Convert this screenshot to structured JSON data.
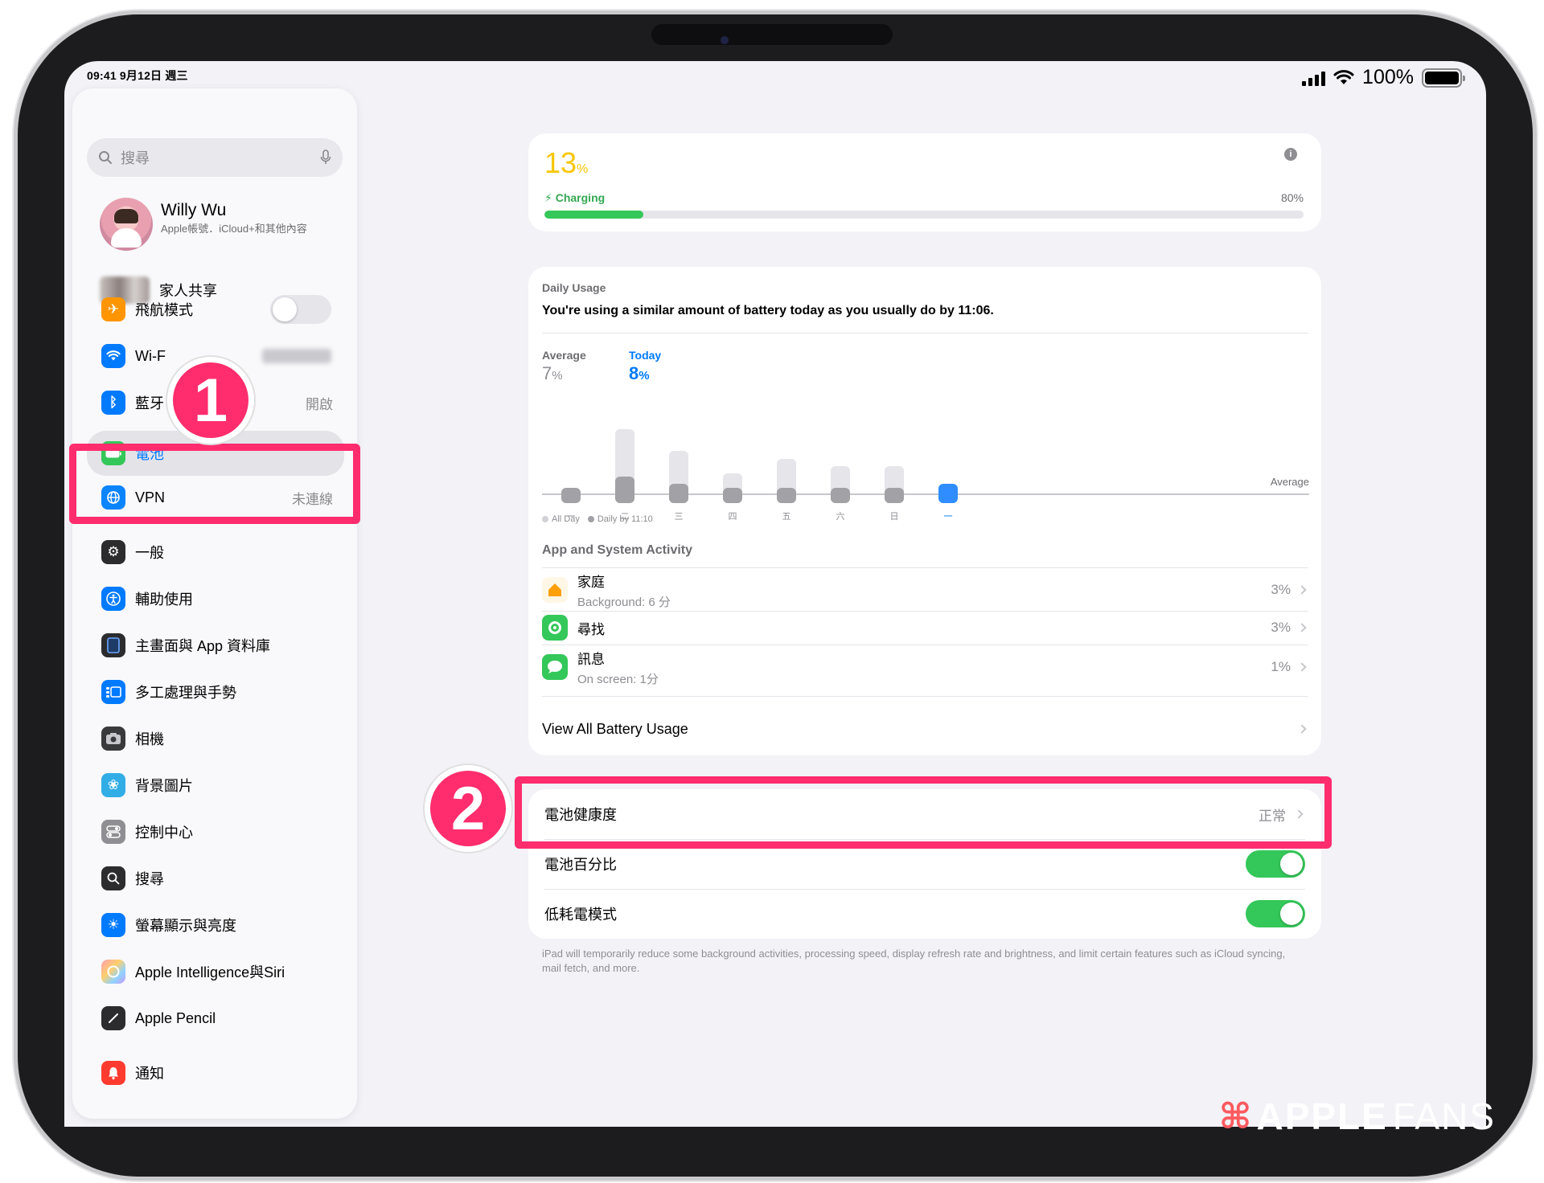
{
  "status_bar": {
    "time_date": "09:41  9月12日 週三",
    "battery_percent": "100%"
  },
  "sidebar": {
    "search_placeholder": "搜尋",
    "profile": {
      "name": "Willy Wu",
      "subtitle": "Apple帳號．iCloud+和其他內容"
    },
    "family_label": "家人共享",
    "group1": [
      {
        "label": "飛航模式",
        "icon": "airplane-icon",
        "color": "#ff9500"
      },
      {
        "label": "Wi-F",
        "icon": "wifi-icon",
        "color": "#007aff"
      },
      {
        "label": "藍牙",
        "icon": "bluetooth-icon",
        "color": "#007aff",
        "value": "開啟"
      },
      {
        "label": "電池",
        "icon": "battery-icon",
        "color": "#34c759",
        "selected": true
      },
      {
        "label": "VPN",
        "icon": "vpn-icon",
        "color": "#0a84ff",
        "value": "未連線"
      }
    ],
    "group2": [
      {
        "label": "一般",
        "icon": "gear-icon",
        "color": "#8e8e93"
      },
      {
        "label": "輔助使用",
        "icon": "accessibility-icon",
        "color": "#007aff"
      },
      {
        "label": "主畫面與 App 資料庫",
        "icon": "home-screen-icon",
        "color": "#2c2c2e"
      },
      {
        "label": "多工處理與手勢",
        "icon": "multitasking-icon",
        "color": "#007aff"
      },
      {
        "label": "相機",
        "icon": "camera-icon",
        "color": "#8e8e93"
      },
      {
        "label": "背景圖片",
        "icon": "wallpaper-icon",
        "color": "#32ade6"
      },
      {
        "label": "控制中心",
        "icon": "control-center-icon",
        "color": "#8e8e93"
      },
      {
        "label": "搜尋",
        "icon": "search-icon",
        "color": "#8e8e93"
      },
      {
        "label": "螢幕顯示與亮度",
        "icon": "brightness-icon",
        "color": "#007aff"
      },
      {
        "label": "Apple Intelligence與Siri",
        "icon": "siri-icon",
        "color": "#ff9fb2"
      },
      {
        "label": "Apple Pencil",
        "icon": "pencil-icon",
        "color": "#2c2c2e"
      },
      {
        "label": "通知",
        "icon": "bell-icon",
        "color": "#ff3b30"
      }
    ]
  },
  "charge_card": {
    "percent": "13",
    "percent_unit": "%",
    "status": "Charging",
    "limit": "80%",
    "level": 0.13,
    "colors": {
      "percent": "#f7c600",
      "bar": "#34c759"
    }
  },
  "usage_card": {
    "label": "Daily Usage",
    "message": "You're using a similar amount of battery today as you usually do by 11:06.",
    "average_label": "Average",
    "average_value": "7",
    "today_label": "Today",
    "today_value": "8",
    "unit": "%",
    "average_line_label": "Average",
    "legend_all_day": "All Day",
    "legend_daily_by": "Daily by 11:10",
    "activity_title": "App and System Activity",
    "apps": [
      {
        "name": "家庭",
        "sub": "Background: 6 分",
        "percent": "3%",
        "icon": "home-app-icon"
      },
      {
        "name": "尋找",
        "sub": "",
        "percent": "3%",
        "icon": "find-my-icon"
      },
      {
        "name": "訊息",
        "sub": "On screen: 1分",
        "percent": "1%",
        "icon": "messages-icon"
      }
    ],
    "view_all": "View All Battery Usage"
  },
  "chart_data": {
    "type": "bar",
    "categories": [
      "一",
      "二",
      "三",
      "四",
      "五",
      "六",
      "日",
      "一"
    ],
    "series": [
      {
        "values": [
          2,
          18,
          12,
          6,
          10,
          8,
          8,
          0
        ]
      },
      {
        "values": [
          2,
          5,
          3,
          2,
          2,
          2,
          2,
          3
        ]
      }
    ],
    "ylim": [
      0,
      22
    ],
    "average_line": 7
  },
  "settings_card": {
    "battery_health_label": "電池健康度",
    "battery_health_value": "正常",
    "battery_percentage_label": "電池百分比",
    "low_power_label": "低耗電模式"
  },
  "footnote": "iPad will temporarily reduce some background activities, processing speed, display refresh rate and brightness, and limit certain features such as iCloud syncing, mail fetch, and more.",
  "annotations": {
    "step1": "1",
    "step2": "2",
    "highlight_color": "#ff2d6d"
  },
  "watermark": {
    "bold": "APPLE",
    "light": "FANS"
  }
}
